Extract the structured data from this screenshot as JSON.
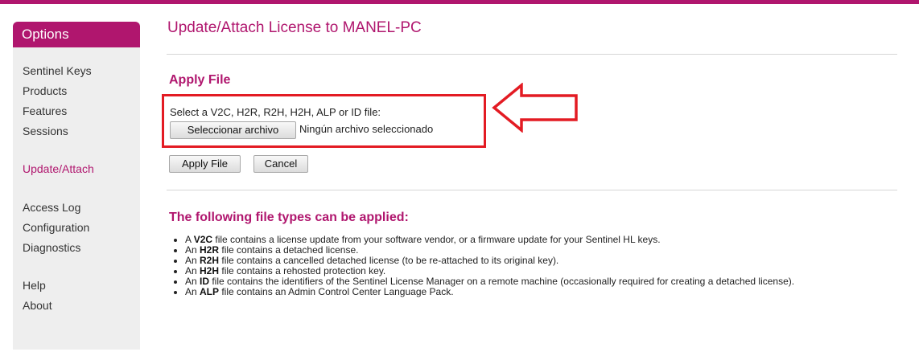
{
  "sidebar": {
    "header": "Options",
    "items": [
      {
        "label": "Sentinel Keys",
        "active": false
      },
      {
        "label": "Products",
        "active": false
      },
      {
        "label": "Features",
        "active": false
      },
      {
        "label": "Sessions",
        "active": false
      },
      {
        "label": "Update/Attach",
        "active": true
      },
      {
        "label": "Access Log",
        "active": false
      },
      {
        "label": "Configuration",
        "active": false
      },
      {
        "label": "Diagnostics",
        "active": false
      },
      {
        "label": "Help",
        "active": false
      },
      {
        "label": "About",
        "active": false
      }
    ]
  },
  "main": {
    "title": "Update/Attach License to MANEL-PC",
    "apply_heading": "Apply File",
    "file_prompt": "Select a V2C, H2R, R2H, H2H, ALP or ID file:",
    "choose_file_label": "Seleccionar archivo",
    "no_file_text": "Ningún archivo seleccionado",
    "apply_button": "Apply File",
    "cancel_button": "Cancel",
    "types_heading": "The following file types can be applied:",
    "types": [
      {
        "pre": "A ",
        "code": "V2C",
        "post": " file contains a license update from your software vendor, or a firmware update for your Sentinel HL keys."
      },
      {
        "pre": "An ",
        "code": "H2R",
        "post": " file contains a detached license."
      },
      {
        "pre": "An ",
        "code": "R2H",
        "post": " file contains a cancelled detached license (to be re-attached to its original key)."
      },
      {
        "pre": "An ",
        "code": "H2H",
        "post": " file contains a rehosted protection key."
      },
      {
        "pre": "An ",
        "code": "ID",
        "post": " file contains the identifiers of the Sentinel License Manager on a remote machine (occasionally required for creating a detached license)."
      },
      {
        "pre": "An ",
        "code": "ALP",
        "post": " file contains an Admin Control Center Language Pack."
      }
    ]
  },
  "annotation": {
    "box_color": "#e31b23",
    "arrow_icon": "left-arrow-outline-icon"
  },
  "colors": {
    "brand": "#b0166e",
    "sidebar_bg": "#eeeeee"
  }
}
